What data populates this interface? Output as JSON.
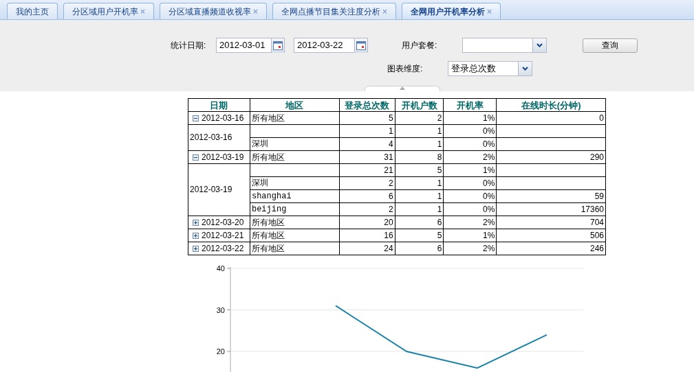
{
  "tabs": [
    {
      "label": "我的主页",
      "selected": false,
      "closable": false
    },
    {
      "label": "分区域用户开机率",
      "selected": false,
      "closable": true
    },
    {
      "label": "分区域直播频道收视率",
      "selected": false,
      "closable": true
    },
    {
      "label": "全网点播节目集关注度分析",
      "selected": false,
      "closable": true
    },
    {
      "label": "全网用户开机率分析",
      "selected": true,
      "closable": true
    }
  ],
  "close_glyph": "×",
  "filters": {
    "date_label": "统计日期:",
    "start_date": "2012-03-01",
    "end_date": "2012-03-22",
    "package_label": "用户套餐:",
    "dimension_label": "图表维度:",
    "dimension_value": "登录总次数",
    "query_button": "查询"
  },
  "table": {
    "columns": [
      "日期",
      "地区",
      "登录总次数",
      "开机户数",
      "开机率",
      "在线时长(分钟)"
    ],
    "groups": [
      {
        "date": "2012-03-16",
        "expanded": true,
        "region": "所有地区",
        "logins": "5",
        "users": "2",
        "rate": "1%",
        "minutes": "0",
        "detail_date": "2012-03-16",
        "details": [
          {
            "logins": "1",
            "users": "1",
            "rate": "0%"
          },
          {
            "region": "深圳",
            "logins": "4",
            "users": "1",
            "rate": "0%"
          }
        ]
      },
      {
        "date": "2012-03-19",
        "expanded": true,
        "region": "所有地区",
        "logins": "31",
        "users": "8",
        "rate": "2%",
        "minutes": "290",
        "detail_date": "2012-03-19",
        "details": [
          {
            "logins": "21",
            "users": "5",
            "rate": "1%"
          },
          {
            "region": "深圳",
            "logins": "2",
            "users": "1",
            "rate": "0%"
          },
          {
            "region": "shanghai",
            "logins": "6",
            "users": "1",
            "rate": "0%",
            "minutes": "59"
          },
          {
            "region": "beijing",
            "logins": "2",
            "users": "1",
            "rate": "0%",
            "minutes": "17360"
          }
        ]
      },
      {
        "date": "2012-03-20",
        "expanded": false,
        "region": "所有地区",
        "logins": "20",
        "users": "6",
        "rate": "2%",
        "minutes": "704"
      },
      {
        "date": "2012-03-21",
        "expanded": false,
        "region": "所有地区",
        "logins": "16",
        "users": "5",
        "rate": "1%",
        "minutes": "506"
      },
      {
        "date": "2012-03-22",
        "expanded": false,
        "region": "所有地区",
        "logins": "24",
        "users": "6",
        "rate": "2%",
        "minutes": "246"
      }
    ]
  },
  "chart_data": {
    "type": "line",
    "ylim": [
      15,
      40
    ],
    "yticks": [
      20,
      30,
      40
    ],
    "series": [
      {
        "color": "#1b82a8",
        "values": [
          null,
          31,
          20,
          16,
          24
        ]
      }
    ]
  }
}
